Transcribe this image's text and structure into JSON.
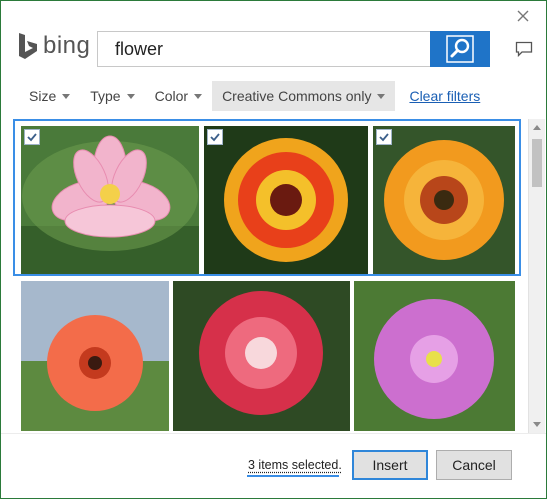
{
  "search": {
    "query": "flower"
  },
  "brand": {
    "name": "bing"
  },
  "filters": [
    {
      "label": "Size",
      "active": false
    },
    {
      "label": "Type",
      "active": false
    },
    {
      "label": "Color",
      "active": false
    },
    {
      "label": "Creative Commons only",
      "active": true
    }
  ],
  "clear_filters_label": "Clear filters",
  "results": [
    {
      "id": "lotus",
      "selected": true
    },
    {
      "id": "zinnia",
      "selected": true
    },
    {
      "id": "gazania",
      "selected": true
    },
    {
      "id": "gerbera",
      "selected": false
    },
    {
      "id": "desert-rose",
      "selected": false
    },
    {
      "id": "pink-lily",
      "selected": false
    }
  ],
  "status_text": "3 items selected.",
  "buttons": {
    "insert": "Insert",
    "cancel": "Cancel"
  },
  "colors": {
    "accent": "#1f74c8",
    "selection": "#3a8ee6",
    "link": "#1a5fb4",
    "window_border": "#2b7a3a"
  },
  "icons": {
    "close": "close-icon",
    "search": "search-icon",
    "feedback": "feedback-icon",
    "checkbox": "checkmark-icon"
  }
}
